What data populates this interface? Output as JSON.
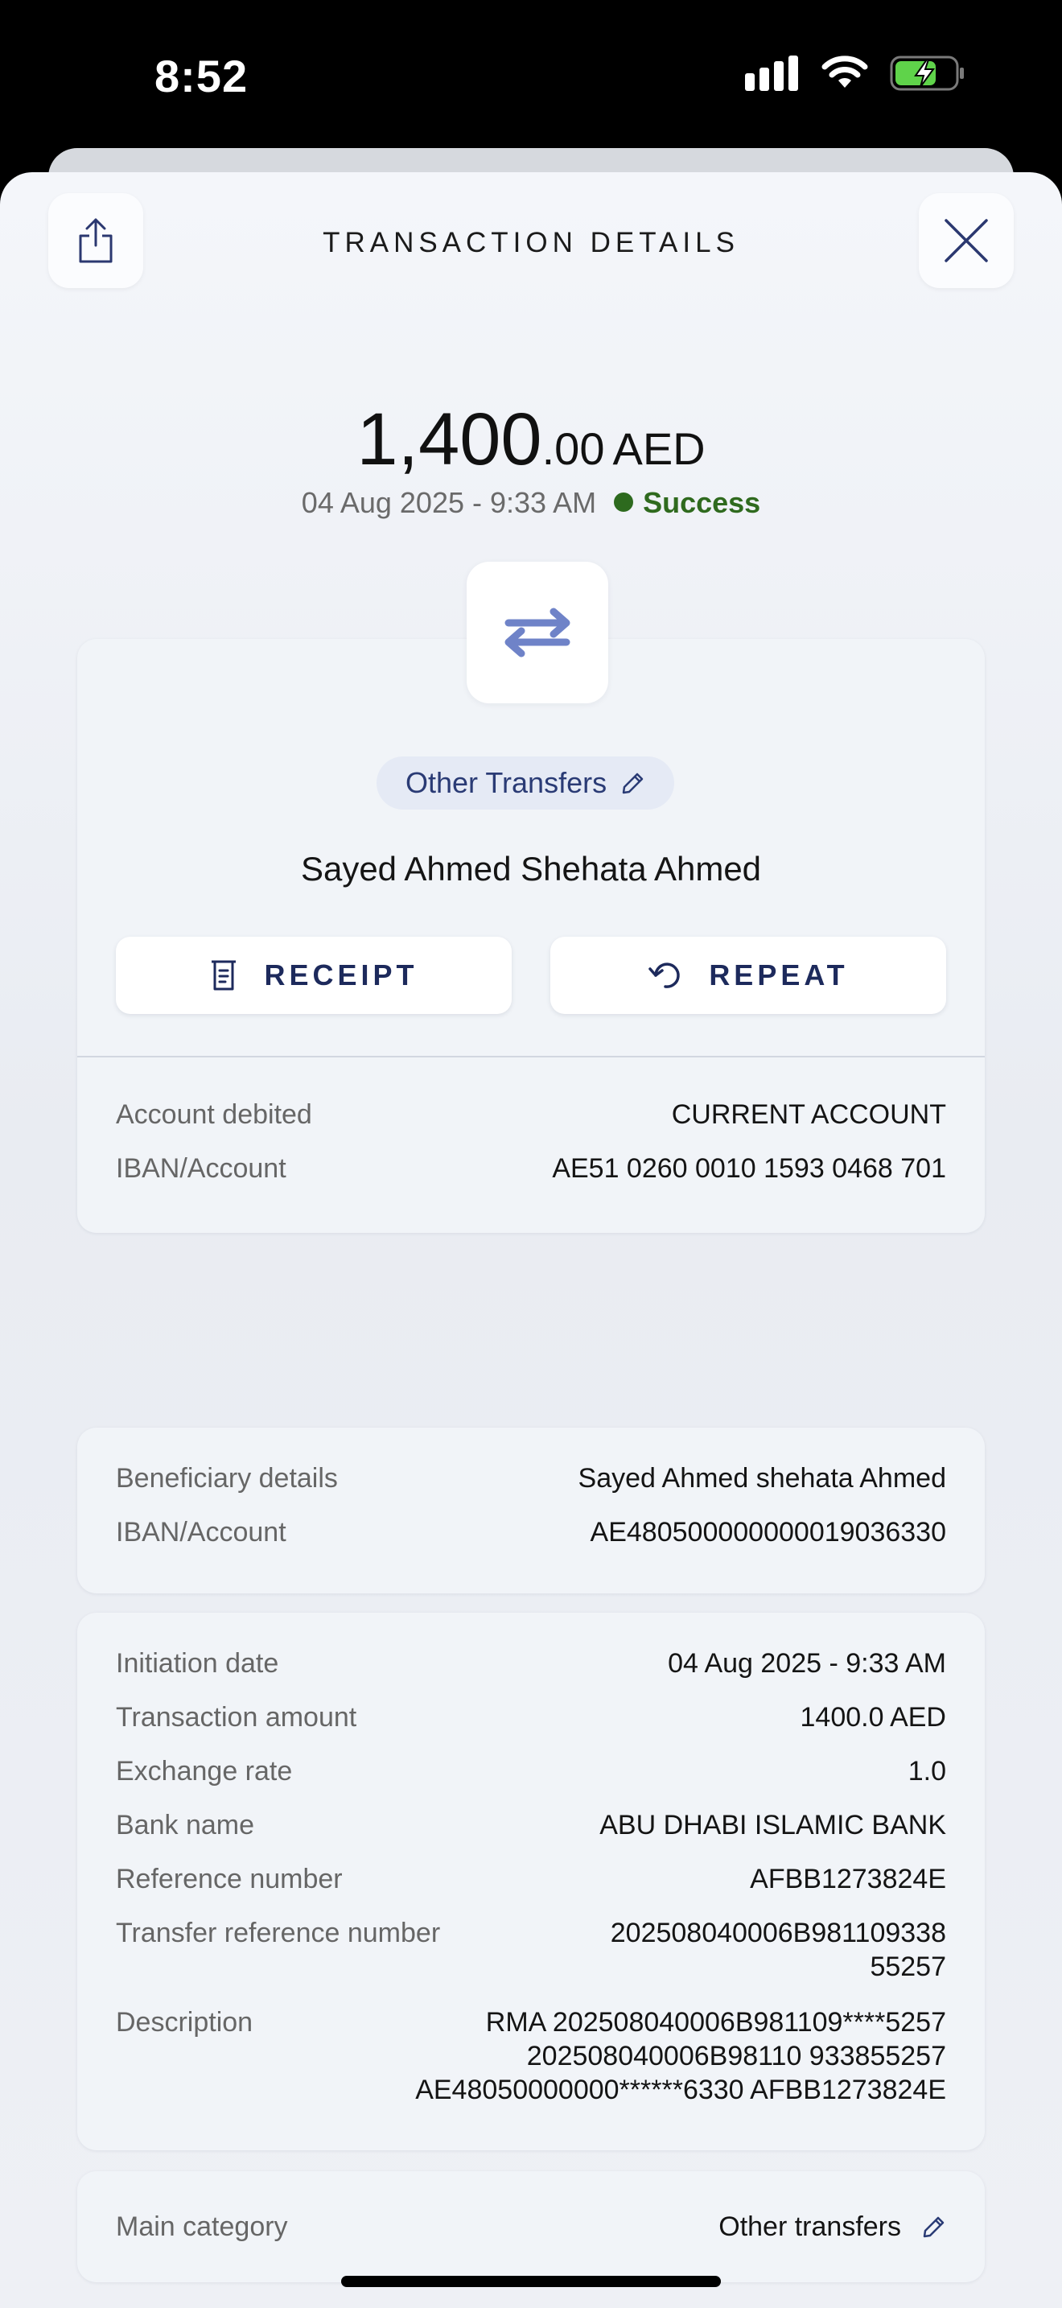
{
  "status_bar": {
    "time": "8:52"
  },
  "header": {
    "title": "TRANSACTION DETAILS"
  },
  "amount": {
    "integer": "1,400",
    "decimal": ".00",
    "currency": "AED"
  },
  "meta": {
    "datetime": "04 Aug 2025 - 9:33 AM",
    "status": "Success",
    "status_color": "#2f6a1e"
  },
  "summary": {
    "category": "Other Transfers",
    "payee": "Sayed Ahmed Shehata Ahmed",
    "receipt_label": "RECEIPT",
    "repeat_label": "REPEAT"
  },
  "account": [
    {
      "label": "Account debited",
      "value": "CURRENT ACCOUNT"
    },
    {
      "label": "IBAN/Account",
      "value": "AE51 0260 0010 1593 0468 701"
    }
  ],
  "beneficiary": [
    {
      "label": "Beneficiary details",
      "value": "Sayed Ahmed shehata Ahmed"
    },
    {
      "label": "IBAN/Account",
      "value": "AE480500000000019036330"
    }
  ],
  "transaction": [
    {
      "label": "Initiation date",
      "value": "04 Aug 2025 - 9:33 AM"
    },
    {
      "label": "Transaction amount",
      "value": "1400.0 AED"
    },
    {
      "label": "Exchange rate",
      "value": "1.0"
    },
    {
      "label": "Bank name",
      "value": "ABU DHABI ISLAMIC BANK"
    },
    {
      "label": "Reference number",
      "value": "AFBB1273824E"
    },
    {
      "label": "Transfer reference number",
      "value_lines": [
        "202508040006B981109338",
        "55257"
      ]
    },
    {
      "label": "Description",
      "value_lines": [
        "RMA 202508040006B981109****5257",
        "202508040006B98110 933855257",
        "AE48050000000******6330 AFBB1273824E"
      ]
    }
  ],
  "main_category": {
    "label": "Main category",
    "value": "Other transfers"
  },
  "colors": {
    "accent": "#1d2a5c",
    "icon_accent": "#6f83c8",
    "success": "#2d6a1e"
  }
}
